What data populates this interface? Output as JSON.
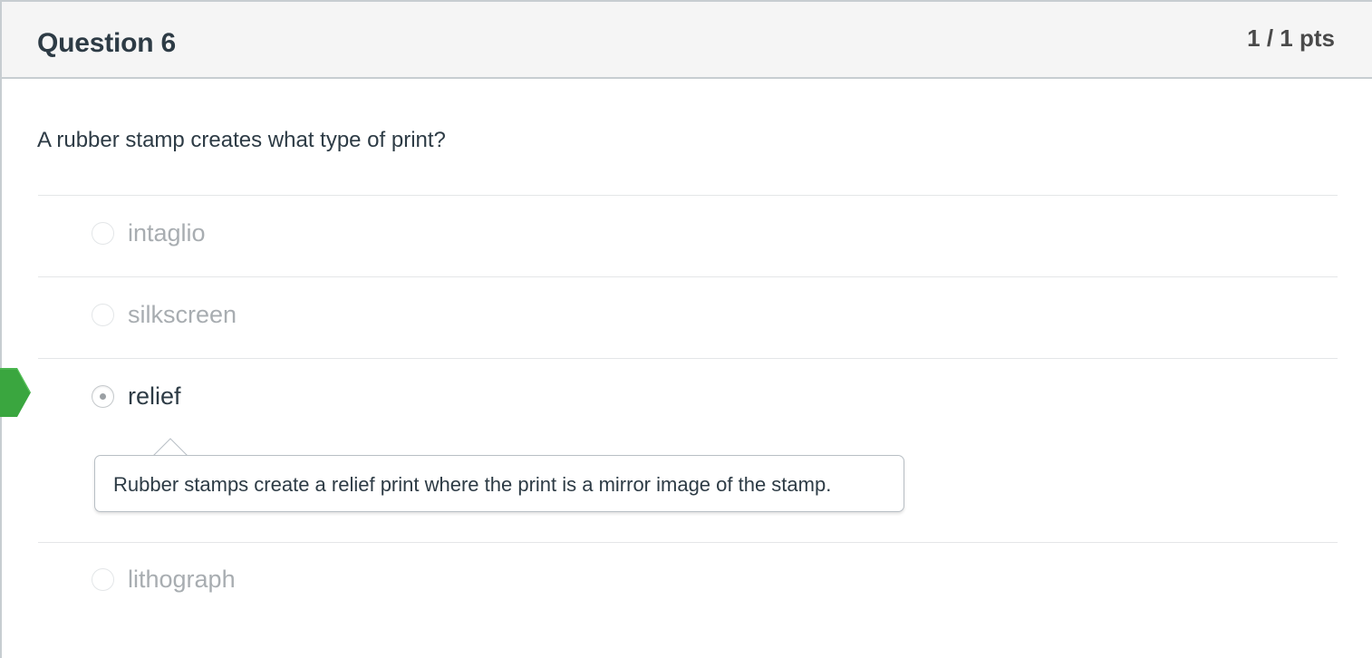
{
  "question": {
    "title": "Question 6",
    "points": "1 / 1 pts",
    "text": "A rubber stamp creates what type of print?"
  },
  "answers": [
    {
      "label": "intaglio",
      "selected": false
    },
    {
      "label": "silkscreen",
      "selected": false
    },
    {
      "label": "relief",
      "selected": true,
      "correct": true
    },
    {
      "label": "lithograph",
      "selected": false
    }
  ],
  "comment": {
    "text": "Rubber stamps create a relief print where the print is a mirror image of the stamp."
  },
  "colors": {
    "correct_marker": "#3aa63f",
    "header_background": "#f5f5f5",
    "unselected_text": "#a8adb1",
    "selected_text": "#2d3b45"
  },
  "icons": {
    "correct_marker": "correct-answer-arrow-icon",
    "radio": "radio-button-icon"
  }
}
